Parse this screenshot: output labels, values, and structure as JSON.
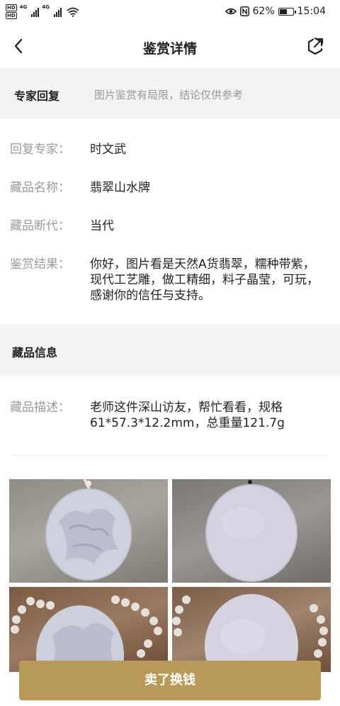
{
  "status_bar": {
    "hd_top": "HD",
    "hd_bottom": "HD",
    "network_1": "4G",
    "network_2": "4G",
    "battery_percent": "62%",
    "battery_level": 0.62,
    "time": "15:04",
    "icons": [
      "hd-icon",
      "signal-icon",
      "wifi-icon",
      "eye-comfort-icon",
      "nfc-icon",
      "battery-icon"
    ]
  },
  "nav": {
    "title": "鉴赏详情",
    "back_icon": "chevron-left-icon",
    "share_icon": "share-icon"
  },
  "expert_section": {
    "title": "专家回复",
    "note": "图片鉴赏有局限，结论仅供参考"
  },
  "details": [
    {
      "label": "回复专家：",
      "value": "时文武"
    },
    {
      "label": "藏品名称：",
      "value": "翡翠山水牌"
    },
    {
      "label": "藏品断代：",
      "value": "当代"
    },
    {
      "label": "鉴赏结果：",
      "value": "你好，图片看是天然A货翡翠，糯种带紫，现代工艺雕，做工精细，料子晶莹，可玩，感谢你的信任与支持。"
    }
  ],
  "info_section": {
    "title": "藏品信息"
  },
  "description": {
    "label": "藏品描述：",
    "value": "老师这件深山访友，帮忙看看，规格61*57.3*12.2mm，总重量121.7g"
  },
  "photos": [
    "jade-pendant-front-photo",
    "jade-pendant-back-photo",
    "jade-pendant-on-beads-front-photo",
    "jade-pendant-on-beads-back-photo"
  ],
  "sell_button": {
    "label": "卖了换钱",
    "color": "#b99a59"
  }
}
